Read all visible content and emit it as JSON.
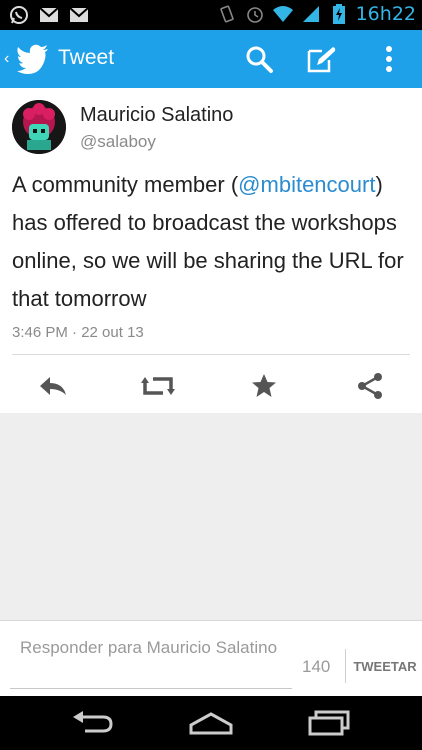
{
  "status_bar": {
    "time": "16h22",
    "left_icons": [
      "whatsapp-icon",
      "gmail-icon",
      "gmail-icon"
    ],
    "right_icons": [
      "vibrate-icon",
      "alarm-icon",
      "wifi-icon",
      "signal-icon",
      "battery-charging-icon"
    ],
    "accent_color": "#33b5e5"
  },
  "action_bar": {
    "title": "Tweet",
    "background_color": "#1ea1e8",
    "icons": [
      "search-icon",
      "compose-icon",
      "overflow-menu-icon"
    ]
  },
  "tweet": {
    "author_name": "Mauricio Salatino",
    "author_handle": "@salaboy",
    "text_before": "A community member (",
    "mention": "@mbitencourt",
    "text_after": ") has offered to broadcast the workshops online, so we will be sharing the URL for that tomorrow",
    "meta": "3:46 PM · 22 out 13",
    "actions": [
      "reply-icon",
      "retweet-icon",
      "favorite-icon",
      "share-icon"
    ]
  },
  "compose": {
    "placeholder": "Responder para Mauricio Salatino",
    "char_count": "140",
    "submit_label": "TWEETAR"
  },
  "nav_bar": {
    "buttons": [
      "back-icon",
      "home-icon",
      "recent-apps-icon"
    ]
  }
}
